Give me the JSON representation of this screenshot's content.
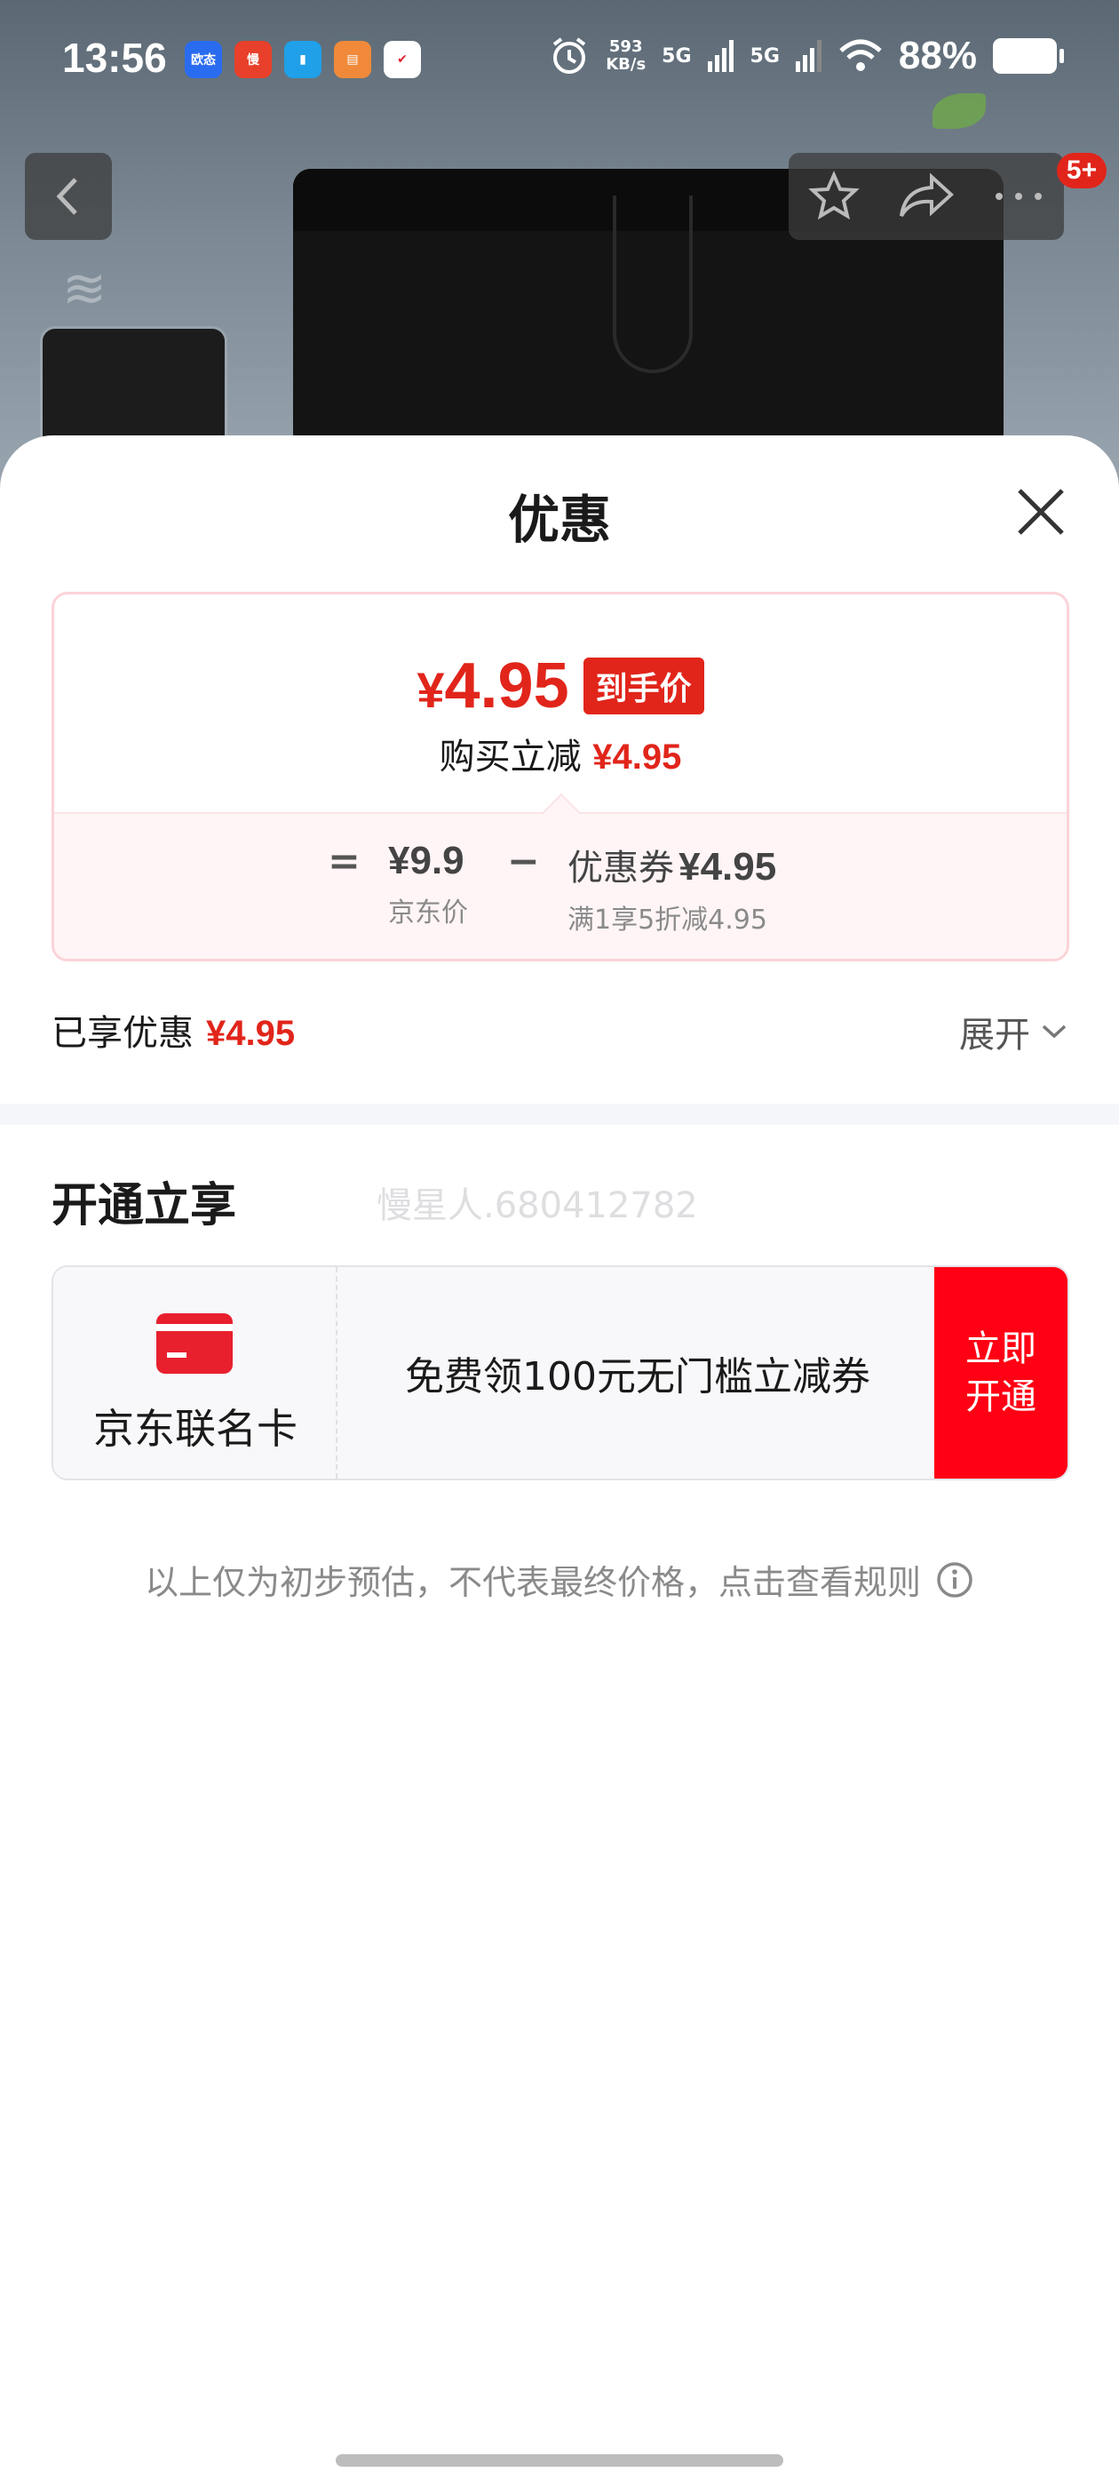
{
  "status_bar": {
    "time": "13:56",
    "app_icons": [
      "欧态",
      "慢",
      "",
      "",
      ""
    ],
    "net_speed_value": "593",
    "net_speed_unit": "KB/s",
    "signal_1": "5G",
    "signal_2": "5G",
    "battery": "88%"
  },
  "nav": {
    "badge": "5+"
  },
  "sheet": {
    "title": "优惠",
    "price_card": {
      "currency": "¥",
      "final_price": "4.95",
      "final_tag": "到手价",
      "discount_label": "购买立减",
      "discount_value": "¥4.95",
      "equals": "=",
      "minus": "−",
      "jd_price": "¥9.9",
      "jd_price_label": "京东价",
      "coupon_label": "优惠券",
      "coupon_value": "¥4.95",
      "coupon_desc": "满1享5折减4.95"
    },
    "enjoyed": {
      "label": "已享优惠",
      "value": "¥4.95"
    },
    "expand_label": "展开",
    "open_section": {
      "title": "开通立享",
      "watermark": "慢星人.680412782",
      "card_name": "京东联名卡",
      "description": "免费领100元无门槛立减券",
      "button": "立即开通"
    },
    "note": "以上仅为初步预估，不代表最终价格，点击查看规则"
  },
  "colors": {
    "accent_red": "#e1251b",
    "button_red": "#ff0014"
  }
}
